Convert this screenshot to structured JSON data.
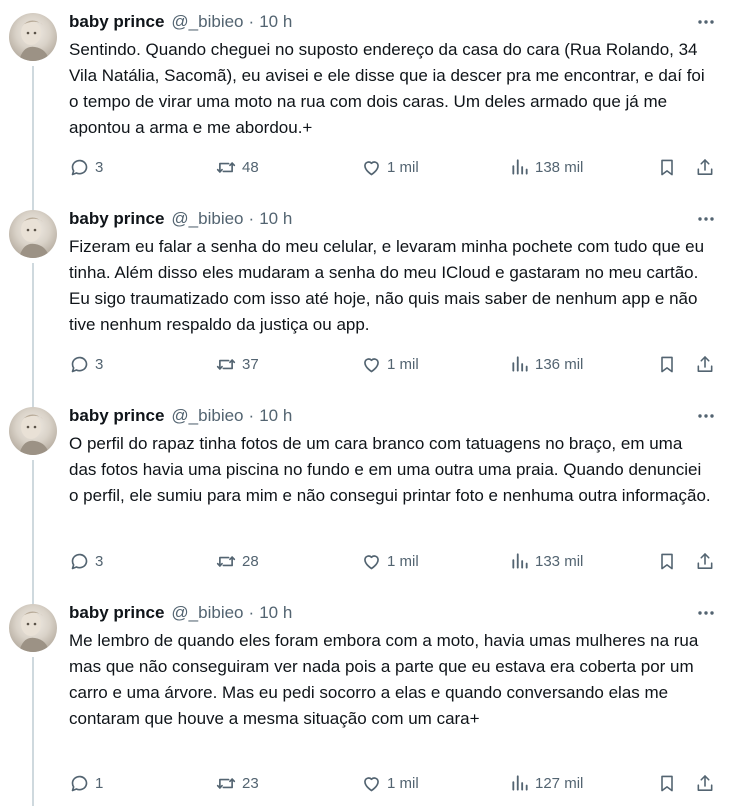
{
  "colors": {
    "text": "#0f1419",
    "muted": "#536471",
    "line": "#cfd9de"
  },
  "tweets": [
    {
      "author": "baby prince",
      "handle": "@_bibieo",
      "separator": "·",
      "time": "10 h",
      "text": "Sentindo. Quando cheguei no suposto endereço da casa do cara (Rua Rolando, 34 Vila Natália, Sacomã), eu avisei e ele disse que ia descer pra me encontrar, e daí foi o tempo de virar uma moto na rua com dois caras. Um deles armado que já me apontou a arma e me abordou.+",
      "replies": "3",
      "retweets": "48",
      "likes": "1 mil",
      "views": "138 mil"
    },
    {
      "author": "baby prince",
      "handle": "@_bibieo",
      "separator": "·",
      "time": "10 h",
      "text": "Fizeram eu falar a senha do meu celular, e levaram minha pochete com tudo que eu tinha. Além disso eles mudaram a senha do meu ICloud e gastaram no meu cartão. Eu sigo traumatizado com isso até hoje, não quis mais saber de nenhum app e não tive nenhum respaldo da justiça ou app.",
      "replies": "3",
      "retweets": "37",
      "likes": "1 mil",
      "views": "136 mil"
    },
    {
      "author": "baby prince",
      "handle": "@_bibieo",
      "separator": "·",
      "time": "10 h",
      "text": "O perfil do rapaz tinha fotos de um cara branco com tatuagens no braço, em uma das fotos havia uma piscina no fundo e em uma outra uma praia. Quando denunciei o perfil, ele sumiu para mim e não consegui printar foto e nenhuma outra informação.",
      "replies": "3",
      "retweets": "28",
      "likes": "1 mil",
      "views": "133 mil"
    },
    {
      "author": "baby prince",
      "handle": "@_bibieo",
      "separator": "·",
      "time": "10 h",
      "text": "Me lembro de quando eles foram embora com a moto, havia umas mulheres na rua mas que não conseguiram ver nada pois a parte que eu estava era coberta por um carro e uma árvore. Mas eu pedi socorro a elas e quando conversando elas me contaram que houve a mesma situação com um cara+",
      "replies": "1",
      "retweets": "23",
      "likes": "1 mil",
      "views": "127 mil"
    }
  ],
  "icons": [
    "avatar",
    "more-icon",
    "reply-icon",
    "retweet-icon",
    "like-icon",
    "views-icon",
    "bookmark-icon",
    "share-icon"
  ]
}
